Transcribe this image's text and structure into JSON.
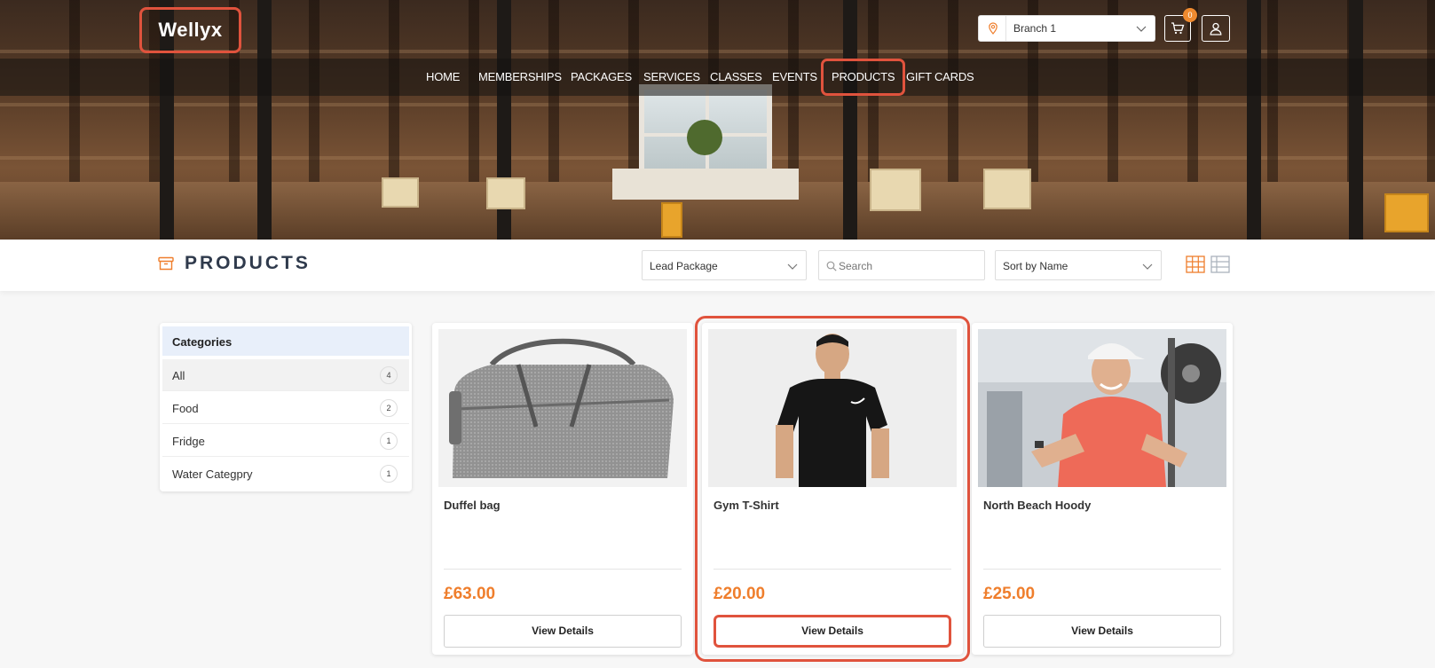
{
  "brand": {
    "name": "Wellyx"
  },
  "nav": {
    "items": [
      "HOME",
      "MEMBERSHIPS",
      "PACKAGES",
      "SERVICES",
      "CLASSES",
      "EVENTS",
      "PRODUCTS",
      "GIFT CARDS"
    ],
    "active": "PRODUCTS"
  },
  "header": {
    "branch": "Branch 1",
    "cart_count": "0",
    "icons": {
      "branch": "location-pin-icon",
      "cart": "cart-icon",
      "user": "user-icon"
    }
  },
  "toolbar": {
    "title": "PRODUCTS",
    "title_icon": "archive-box-icon",
    "package_filter": "Lead Package",
    "search_placeholder": "Search",
    "sort": "Sort by Name",
    "view_modes": [
      "grid-view-icon",
      "list-view-icon"
    ],
    "active_view": "grid-view-icon"
  },
  "categories": {
    "title": "Categories",
    "items": [
      {
        "label": "All",
        "count": "4"
      },
      {
        "label": "Food",
        "count": "2"
      },
      {
        "label": "Fridge",
        "count": "1"
      },
      {
        "label": "Water Categpry",
        "count": "1"
      }
    ],
    "selected": "All"
  },
  "products": [
    {
      "name": "Duffel bag",
      "price": "£63.00",
      "button": "View Details",
      "image": "grey-duffel-bag"
    },
    {
      "name": "Gym T-Shirt",
      "price": "£20.00",
      "button": "View Details",
      "image": "man-in-black-tshirt"
    },
    {
      "name": "North Beach Hoody",
      "price": "£25.00",
      "button": "View Details",
      "image": "man-in-red-shirt-gym"
    }
  ],
  "colors": {
    "accent": "#ef7e2c",
    "highlight": "#e0533d",
    "title": "#2f3a4c"
  }
}
